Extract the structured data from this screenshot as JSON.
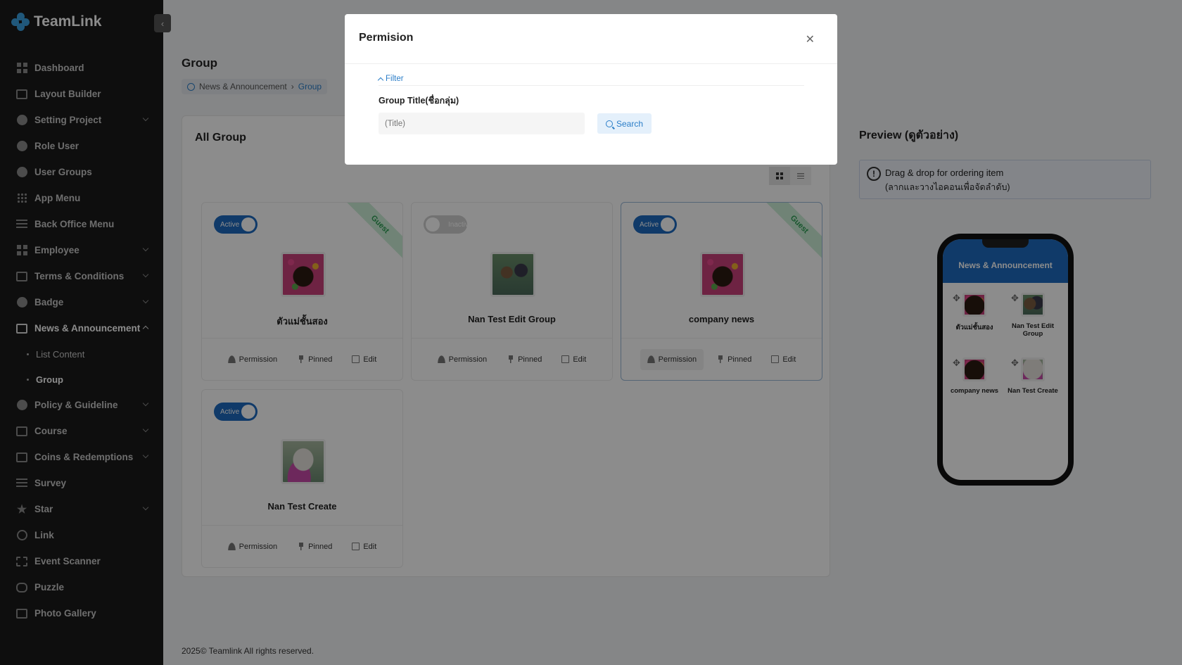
{
  "app": {
    "name": "TeamLink"
  },
  "sidebar": {
    "items": [
      {
        "label": "Dashboard",
        "icon": "dashboard-icon"
      },
      {
        "label": "Layout Builder",
        "icon": "layout-icon"
      },
      {
        "label": "Setting Project",
        "icon": "gear-icon",
        "expandable": true
      },
      {
        "label": "Role User",
        "icon": "users-icon"
      },
      {
        "label": "User Groups",
        "icon": "user-groups-icon"
      },
      {
        "label": "App Menu",
        "icon": "app-menu-icon"
      },
      {
        "label": "Back Office Menu",
        "icon": "list-icon"
      },
      {
        "label": "Employee",
        "icon": "employee-icon",
        "expandable": true
      },
      {
        "label": "Terms & Conditions",
        "icon": "terms-icon",
        "expandable": true
      },
      {
        "label": "Badge",
        "icon": "badge-icon",
        "expandable": true
      },
      {
        "label": "News & Announcement",
        "icon": "news-icon",
        "expandable": true,
        "expanded": true
      },
      {
        "label": "Policy & Guideline",
        "icon": "shield-icon",
        "expandable": true
      },
      {
        "label": "Course",
        "icon": "graduation-icon",
        "expandable": true
      },
      {
        "label": "Coins & Redemptions",
        "icon": "wallet-icon",
        "expandable": true
      },
      {
        "label": "Survey",
        "icon": "survey-icon"
      },
      {
        "label": "Star",
        "icon": "star-icon",
        "expandable": true
      },
      {
        "label": "Link",
        "icon": "link-icon"
      },
      {
        "label": "Event Scanner",
        "icon": "scanner-icon"
      },
      {
        "label": "Puzzle",
        "icon": "gamepad-icon"
      },
      {
        "label": "Photo Gallery",
        "icon": "gallery-icon"
      }
    ],
    "subitems": [
      {
        "label": "List Content"
      },
      {
        "label": "Group"
      }
    ]
  },
  "page": {
    "title": "Group",
    "breadcrumb": [
      "News & Announcement",
      "Group"
    ]
  },
  "panel": {
    "title": "All Group"
  },
  "cards": [
    {
      "status": "Active",
      "name": "ตัวแม่ชั้นสอง",
      "guest": "Guest"
    },
    {
      "status": "Inactive",
      "name": "Nan Test Edit Group",
      "guest": ""
    },
    {
      "status": "Active",
      "name": "company news",
      "guest": "Guest"
    },
    {
      "status": "Active",
      "name": "Nan Test Create",
      "guest": ""
    }
  ],
  "card_actions": {
    "permission": "Permission",
    "pinned": "Pinned",
    "edit": "Edit"
  },
  "preview": {
    "title": "Preview (ดูตัวอย่าง)",
    "notice_line1": "Drag & drop for ordering item",
    "notice_line2": "(ลากและวางไอคอนเพื่อจัดลำดับ)",
    "phone_header": "News & Announcement",
    "items": [
      "ตัวแม่ชั้นสอง",
      "Nan Test Edit Group",
      "company news",
      "Nan Test Create"
    ]
  },
  "footer": "2025© Teamlink All rights reserved.",
  "modal": {
    "title": "Permision",
    "filter_label": "Filter",
    "field_label": "Group Title(ชื่อกลุ่ม)",
    "field_placeholder": "(Title)",
    "search_label": "Search"
  },
  "colors": {
    "primary": "#1e6bbf",
    "sidebar_bg": "#1a1a1a",
    "guest_ribbon": "#cdeed8"
  }
}
